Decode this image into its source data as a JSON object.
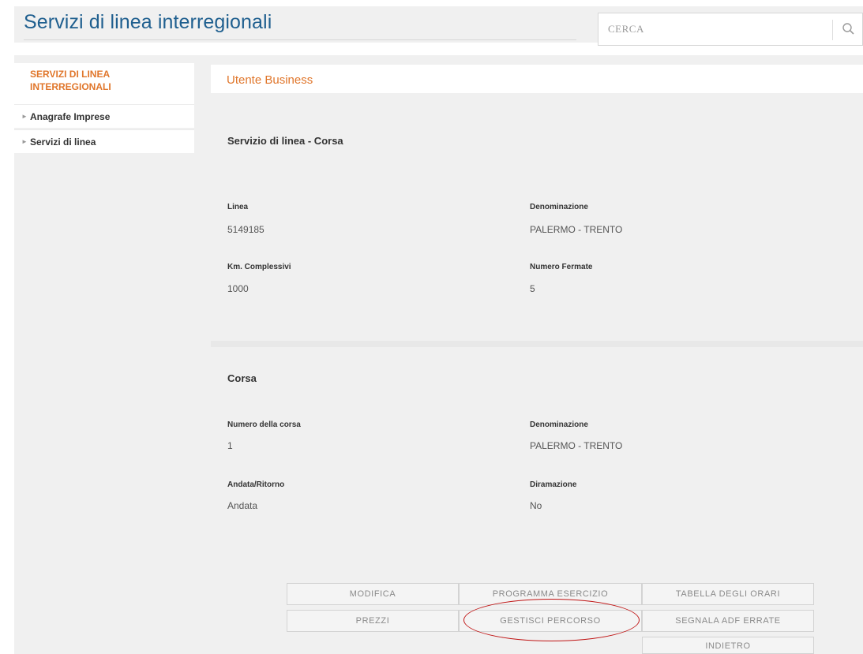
{
  "header": {
    "title": "Servizi di linea interregionali",
    "search_placeholder": "CERCA",
    "search_icon": "search-icon"
  },
  "sidebar": {
    "header": "SERVIZI DI LINEA INTERREGIONALI",
    "items": [
      {
        "label": "Anagrafe Imprese"
      },
      {
        "label": "Servizi di linea"
      }
    ]
  },
  "main": {
    "user_label": "Utente Business",
    "servizio": {
      "title": "Servizio di linea - Corsa",
      "linea_label": "Linea",
      "linea_value": "5149185",
      "denominazione_label": "Denominazione",
      "denominazione_value": "PALERMO - TRENTO",
      "km_label": "Km. Complessivi",
      "km_value": "1000",
      "fermate_label": "Numero Fermate",
      "fermate_value": "5"
    },
    "corsa": {
      "title": "Corsa",
      "numero_label": "Numero della corsa",
      "numero_value": "1",
      "denominazione_label": "Denominazione",
      "denominazione_value": "PALERMO - TRENTO",
      "andata_label": "Andata/Ritorno",
      "andata_value": "Andata",
      "diramazione_label": "Diramazione",
      "diramazione_value": "No"
    }
  },
  "actions": {
    "modifica": "MODIFICA",
    "programma": "PROGRAMMA ESERCIZIO",
    "tabella": "TABELLA DEGLI ORARI",
    "prezzi": "PREZZI",
    "gestisci": "GESTISCI PERCORSO",
    "segnala": "SEGNALA ADF ERRATE",
    "indietro": "INDIETRO"
  },
  "colors": {
    "title_blue": "#1f5f8f",
    "accent_orange": "#e0762b",
    "annotation_red": "#c01515"
  }
}
